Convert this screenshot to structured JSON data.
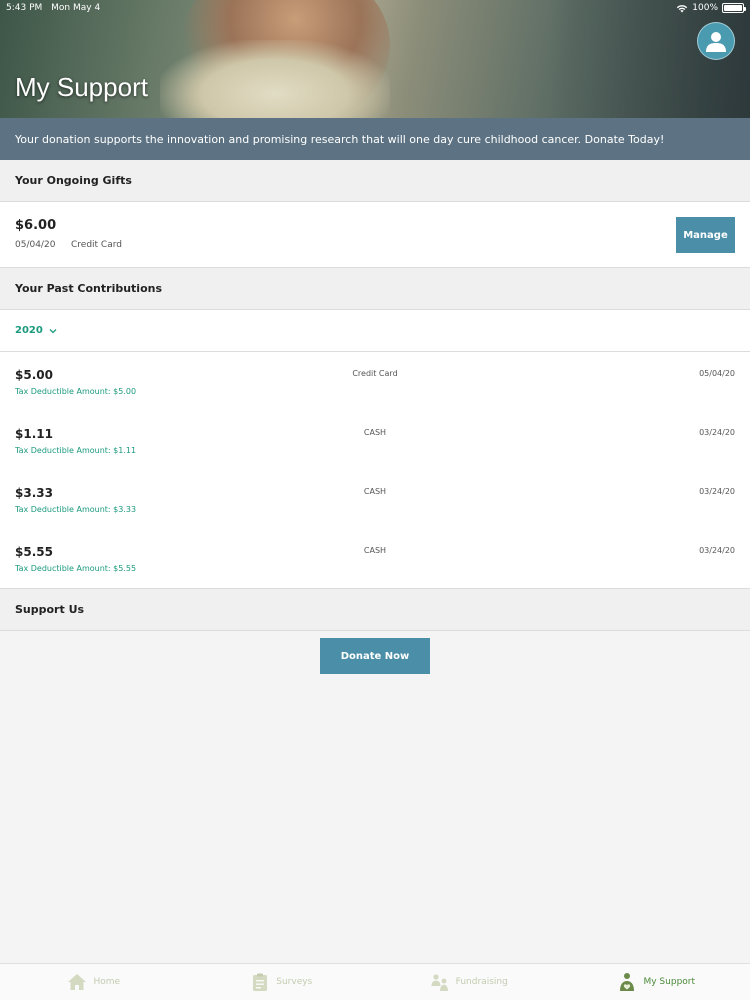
{
  "status_bar": {
    "time": "5:43 PM",
    "date": "Mon May 4",
    "battery": "100%",
    "battery_fill": 1.0
  },
  "header": {
    "title": "My Support"
  },
  "banner": {
    "text": "Your donation supports the innovation and promising research that will one day cure childhood cancer. Donate Today!"
  },
  "ongoing": {
    "heading": "Your Ongoing Gifts",
    "gift": {
      "amount": "$6.00",
      "date": "05/04/20",
      "method": "Credit Card"
    },
    "manage_label": "Manage"
  },
  "past": {
    "heading": "Your Past Contributions",
    "year": "2020",
    "items": [
      {
        "amount": "$5.00",
        "tax": "Tax Deductible Amount: $5.00",
        "method": "Credit Card",
        "date": "05/04/20"
      },
      {
        "amount": "$1.11",
        "tax": "Tax Deductible Amount: $1.11",
        "method": "CASH",
        "date": "03/24/20"
      },
      {
        "amount": "$3.33",
        "tax": "Tax Deductible Amount: $3.33",
        "method": "CASH",
        "date": "03/24/20"
      },
      {
        "amount": "$5.55",
        "tax": "Tax Deductible Amount: $5.55",
        "method": "CASH",
        "date": "03/24/20"
      }
    ]
  },
  "support": {
    "heading": "Support Us",
    "donate_label": "Donate Now"
  },
  "tabs": [
    {
      "label": "Home",
      "icon": "home-icon",
      "active": false
    },
    {
      "label": "Surveys",
      "icon": "clipboard-icon",
      "active": false
    },
    {
      "label": "Fundraising",
      "icon": "people-icon",
      "active": false
    },
    {
      "label": "My Support",
      "icon": "support-icon",
      "active": true
    }
  ],
  "colors": {
    "accent": "#4a8ea8",
    "banner": "#5d7383",
    "green_text": "#1c9a7e",
    "tab_active": "#4a8a3a"
  }
}
